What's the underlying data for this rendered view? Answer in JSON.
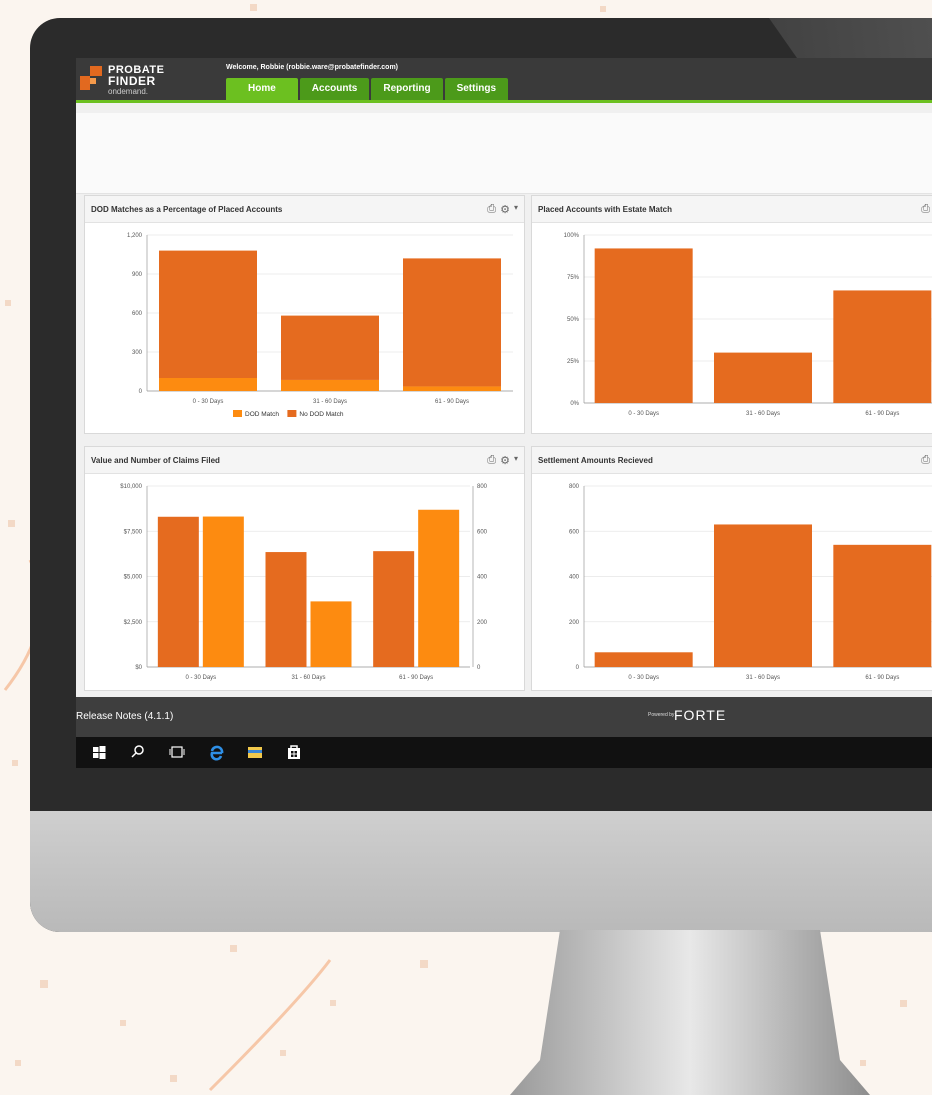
{
  "app": {
    "logo_line1": "PROBATE",
    "logo_line2": "FINDER",
    "logo_line3": "ondemand.",
    "welcome": "Welcome, Robbie (robbie.ware@probatefinder.com)"
  },
  "nav": {
    "tabs": [
      "Home",
      "Accounts",
      "Reporting",
      "Settings"
    ],
    "active": "Home"
  },
  "colors": {
    "accent": "#e56b1f",
    "secondary": "#fd8b10",
    "nav_green": "#6cc020"
  },
  "panels": [
    {
      "title": "DOD Matches as a Percentage of Placed Accounts"
    },
    {
      "title": "Placed Accounts with Estate Match"
    },
    {
      "title": "Value and Number of Claims Filed"
    },
    {
      "title": "Settlement Amounts Recieved"
    }
  ],
  "footer": {
    "release_notes": "Release Notes (4.1.1)",
    "powered_by": "Powered by",
    "brand": "FORTE"
  },
  "taskbar": {
    "icons": [
      "windows-start-icon",
      "search-icon",
      "task-view-icon",
      "edge-icon",
      "file-explorer-icon",
      "store-icon"
    ]
  },
  "chart_data": [
    {
      "type": "bar",
      "stacked": true,
      "categories": [
        "0 - 30 Days",
        "31 - 60 Days",
        "61 - 90 Days"
      ],
      "series": [
        {
          "name": "DOD Match",
          "values": [
            100,
            85,
            35
          ],
          "color": "#fd8b10"
        },
        {
          "name": "No DOD Match",
          "values": [
            980,
            495,
            985
          ],
          "color": "#e56b1f"
        }
      ],
      "yticks": [
        "0",
        "300",
        "600",
        "900",
        "1,200"
      ],
      "ylim": [
        0,
        1200
      ],
      "legend": "bottom"
    },
    {
      "type": "bar",
      "categories": [
        "0 - 30 Days",
        "31 - 60 Days",
        "61 - 90 Days"
      ],
      "series": [
        {
          "values": [
            92,
            30,
            67
          ],
          "color": "#e56b1f"
        }
      ],
      "yticks": [
        "0%",
        "25%",
        "50%",
        "75%",
        "100%"
      ],
      "ylim": [
        0,
        100
      ]
    },
    {
      "type": "bar",
      "categories": [
        "0 - 30 Days",
        "31 - 60 Days",
        "61 - 90 Days"
      ],
      "series": [
        {
          "axis": "left",
          "values": [
            8300,
            6350,
            6400
          ],
          "color": "#e56b1f"
        },
        {
          "axis": "right",
          "values": [
            665,
            290,
            695
          ],
          "color": "#fd8b10"
        }
      ],
      "yticks": [
        "$0",
        "$2,500",
        "$5,000",
        "$7,500",
        "$10,000"
      ],
      "ylim": [
        0,
        10000
      ],
      "y2ticks": [
        "0",
        "200",
        "400",
        "600",
        "800"
      ],
      "y2lim": [
        0,
        800
      ]
    },
    {
      "type": "bar",
      "categories": [
        "0 - 30 Days",
        "31 - 60 Days",
        "61 - 90 Days"
      ],
      "series": [
        {
          "values": [
            65,
            630,
            540
          ],
          "color": "#e56b1f"
        }
      ],
      "yticks": [
        "0",
        "200",
        "400",
        "600",
        "800"
      ],
      "ylim": [
        0,
        800
      ]
    }
  ]
}
